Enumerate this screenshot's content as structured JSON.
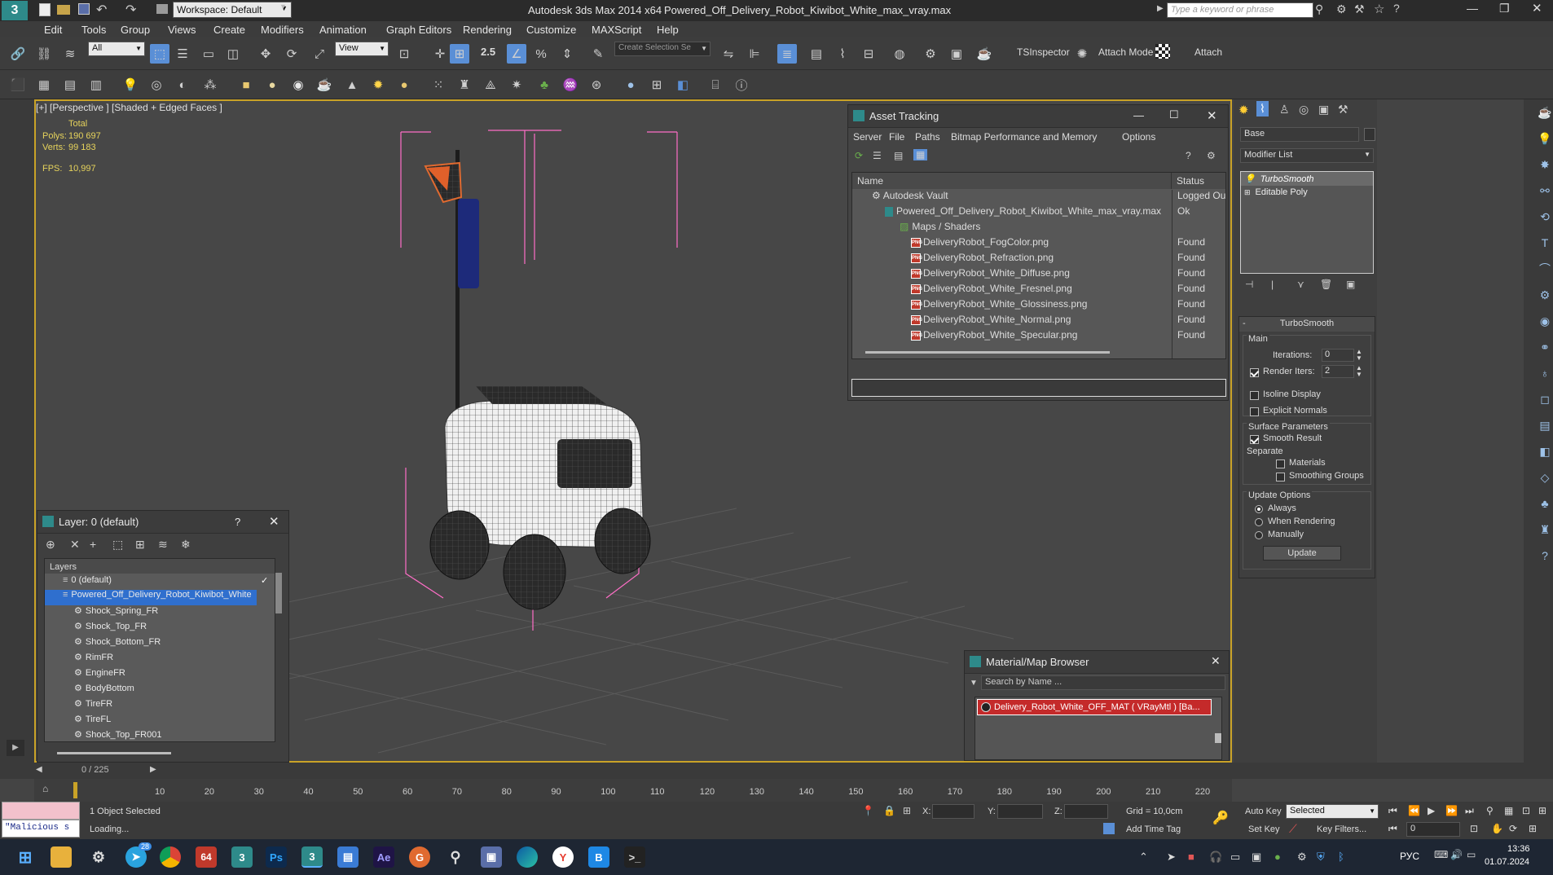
{
  "titlebar": {
    "workspace_label": "Workspace: Default",
    "app_title": "Autodesk 3ds Max  2014 x64",
    "file_title": "Powered_Off_Delivery_Robot_Kiwibot_White_max_vray.max",
    "search_placeholder": "Type a keyword or phrase"
  },
  "menu": [
    "Edit",
    "Tools",
    "Group",
    "Views",
    "Create",
    "Modifiers",
    "Animation",
    "Graph Editors",
    "Rendering",
    "Customize",
    "MAXScript",
    "Help"
  ],
  "toolbar": {
    "filter_value": "All",
    "refcoord_value": "View",
    "snap_value": "2.5",
    "selection_set_placeholder": "Create Selection Se",
    "tsinspector": "TSInspector",
    "attach_mode": "Attach Mode",
    "attach": "Attach"
  },
  "viewport": {
    "label": "[+] [Perspective ] [Shaded + Edged Faces ]",
    "stats_total_label": "Total",
    "polys_label": "Polys:",
    "polys_value": "190 697",
    "verts_label": "Verts:",
    "verts_value": "99 183",
    "fps_label": "FPS:",
    "fps_value": "10,997"
  },
  "asset_tracking": {
    "title": "Asset Tracking",
    "menus": [
      "Server",
      "File",
      "Paths",
      "Bitmap Performance and Memory",
      "Options"
    ],
    "col_name": "Name",
    "col_status": "Status",
    "rows": [
      {
        "name": "Autodesk Vault",
        "status": "Logged Out",
        "indent": 1
      },
      {
        "name": "Powered_Off_Delivery_Robot_Kiwibot_White_max_vray.max",
        "status": "Ok",
        "indent": 2
      },
      {
        "name": "Maps / Shaders",
        "status": "",
        "indent": 3
      },
      {
        "name": "DeliveryRobot_FogColor.png",
        "status": "Found",
        "indent": 4
      },
      {
        "name": "DeliveryRobot_Refraction.png",
        "status": "Found",
        "indent": 4
      },
      {
        "name": "DeliveryRobot_White_Diffuse.png",
        "status": "Found",
        "indent": 4
      },
      {
        "name": "DeliveryRobot_White_Fresnel.png",
        "status": "Found",
        "indent": 4
      },
      {
        "name": "DeliveryRobot_White_Glossiness.png",
        "status": "Found",
        "indent": 4
      },
      {
        "name": "DeliveryRobot_White_Normal.png",
        "status": "Found",
        "indent": 4
      },
      {
        "name": "DeliveryRobot_White_Specular.png",
        "status": "Found",
        "indent": 4
      }
    ]
  },
  "layer_window": {
    "title": "Layer: 0 (default)",
    "help": "?",
    "header": "Layers",
    "items": [
      "0 (default)",
      "Powered_Off_Delivery_Robot_Kiwibot_White",
      "Shock_Spring_FR",
      "Shock_Top_FR",
      "Shock_Bottom_FR",
      "RimFR",
      "EngineFR",
      "BodyBottom",
      "TireFR",
      "TireFL",
      "Shock_Top_FR001"
    ]
  },
  "material_browser": {
    "title": "Material/Map Browser",
    "search_placeholder": "Search by Name ...",
    "material_name": "Delivery_Robot_White_OFF_MAT ( VRayMtl ) ",
    "material_tag": "[Ba..."
  },
  "command_panel": {
    "object_name": "Base",
    "modifier_list": "Modifier List",
    "stack": [
      "TurboSmooth",
      "Editable Poly"
    ],
    "rollout_title": "TurboSmooth",
    "main": "Main",
    "iterations_label": "Iterations:",
    "iterations_value": "0",
    "render_iters_label": "Render Iters:",
    "render_iters_value": "2",
    "isoline": "Isoline Display",
    "explicit": "Explicit Normals",
    "surface_params": "Surface Parameters",
    "smooth_result": "Smooth Result",
    "separate": "Separate",
    "materials": "Materials",
    "smoothing_groups": "Smoothing Groups",
    "update_options": "Update Options",
    "always": "Always",
    "when_rendering": "When Rendering",
    "manually": "Manually",
    "update_btn": "Update"
  },
  "timeline": {
    "frame_label": "0 / 225",
    "ticks": [
      "10",
      "20",
      "30",
      "40",
      "50",
      "60",
      "70",
      "80",
      "90",
      "100",
      "110",
      "120",
      "130",
      "140",
      "150",
      "160",
      "170",
      "180",
      "190",
      "200",
      "210",
      "220"
    ]
  },
  "status": {
    "maxscript": "\"Malicious s",
    "selected": "1 Object Selected",
    "loading": "Loading...",
    "x_label": "X:",
    "y_label": "Y:",
    "z_label": "Z:",
    "grid": "Grid = 10,0cm",
    "add_time_tag": "Add Time Tag",
    "auto_key": "Auto Key",
    "set_key": "Set Key",
    "selected_dropdown": "Selected",
    "key_filters": "Key Filters...",
    "frame_value": "0"
  },
  "taskbar": {
    "lang": "РУС",
    "time": "13:36",
    "date": "01.07.2024",
    "badge64": "64",
    "telegram_count": "28"
  },
  "colors": {
    "accent_yellow": "#c9a227",
    "selection_blue": "#2f6fce",
    "found": "#dcdcdc"
  }
}
